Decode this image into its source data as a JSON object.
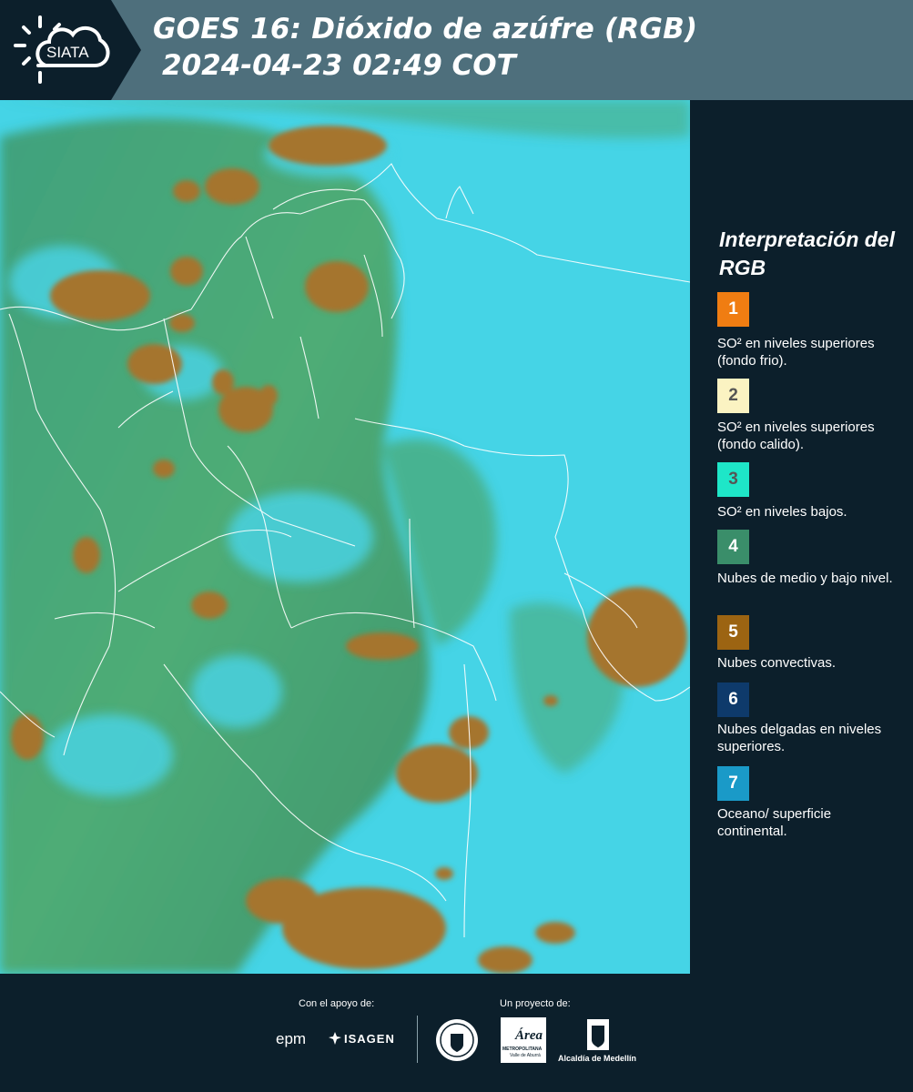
{
  "header": {
    "logo_text": "SIATA",
    "title_line1": "GOES 16: Dióxido de azúfre (RGB)",
    "title_line2": "2024-04-23 02:49 COT"
  },
  "legend": {
    "title": "Interpretación del RGB",
    "items": [
      {
        "number": "1",
        "color": "#f07d12",
        "text": "SO² en niveles superiores (fondo frio)."
      },
      {
        "number": "2",
        "color": "#fbf3c2",
        "text": "SO² en niveles superiores (fondo calido)."
      },
      {
        "number": "3",
        "color": "#1ee6c8",
        "text": "SO² en niveles bajos."
      },
      {
        "number": "4",
        "color": "#3a8e6a",
        "text": "Nubes de medio y bajo nivel."
      },
      {
        "number": "5",
        "color": "#9c6412",
        "text": "Nubes convectivas."
      },
      {
        "number": "6",
        "color": "#0e3a6b",
        "text": "Nubes delgadas en niveles superiores."
      },
      {
        "number": "7",
        "color": "#1a9ac8",
        "text": "Oceano/ superficie continental."
      }
    ]
  },
  "footer": {
    "support_label": "Con el apoyo de:",
    "project_label": "Un proyecto de:",
    "sponsors": [
      "epm",
      "ISAGEN"
    ],
    "partners": [
      "Área Metropolitana Valle de Aburrá",
      "Alcaldía de Medellín"
    ],
    "alcaldia_text": "Alcaldía de Medellín",
    "area_text": "Área",
    "area_sub": "METROPOLITANA",
    "area_sub2": "Valle de Aburrá"
  },
  "colors": {
    "background": "#0c1f2b",
    "header": "#4e6f7c",
    "ocean_cyan": "#3fd0e4",
    "land_green": "#4a9a5a",
    "convective_brown": "#a07030"
  }
}
